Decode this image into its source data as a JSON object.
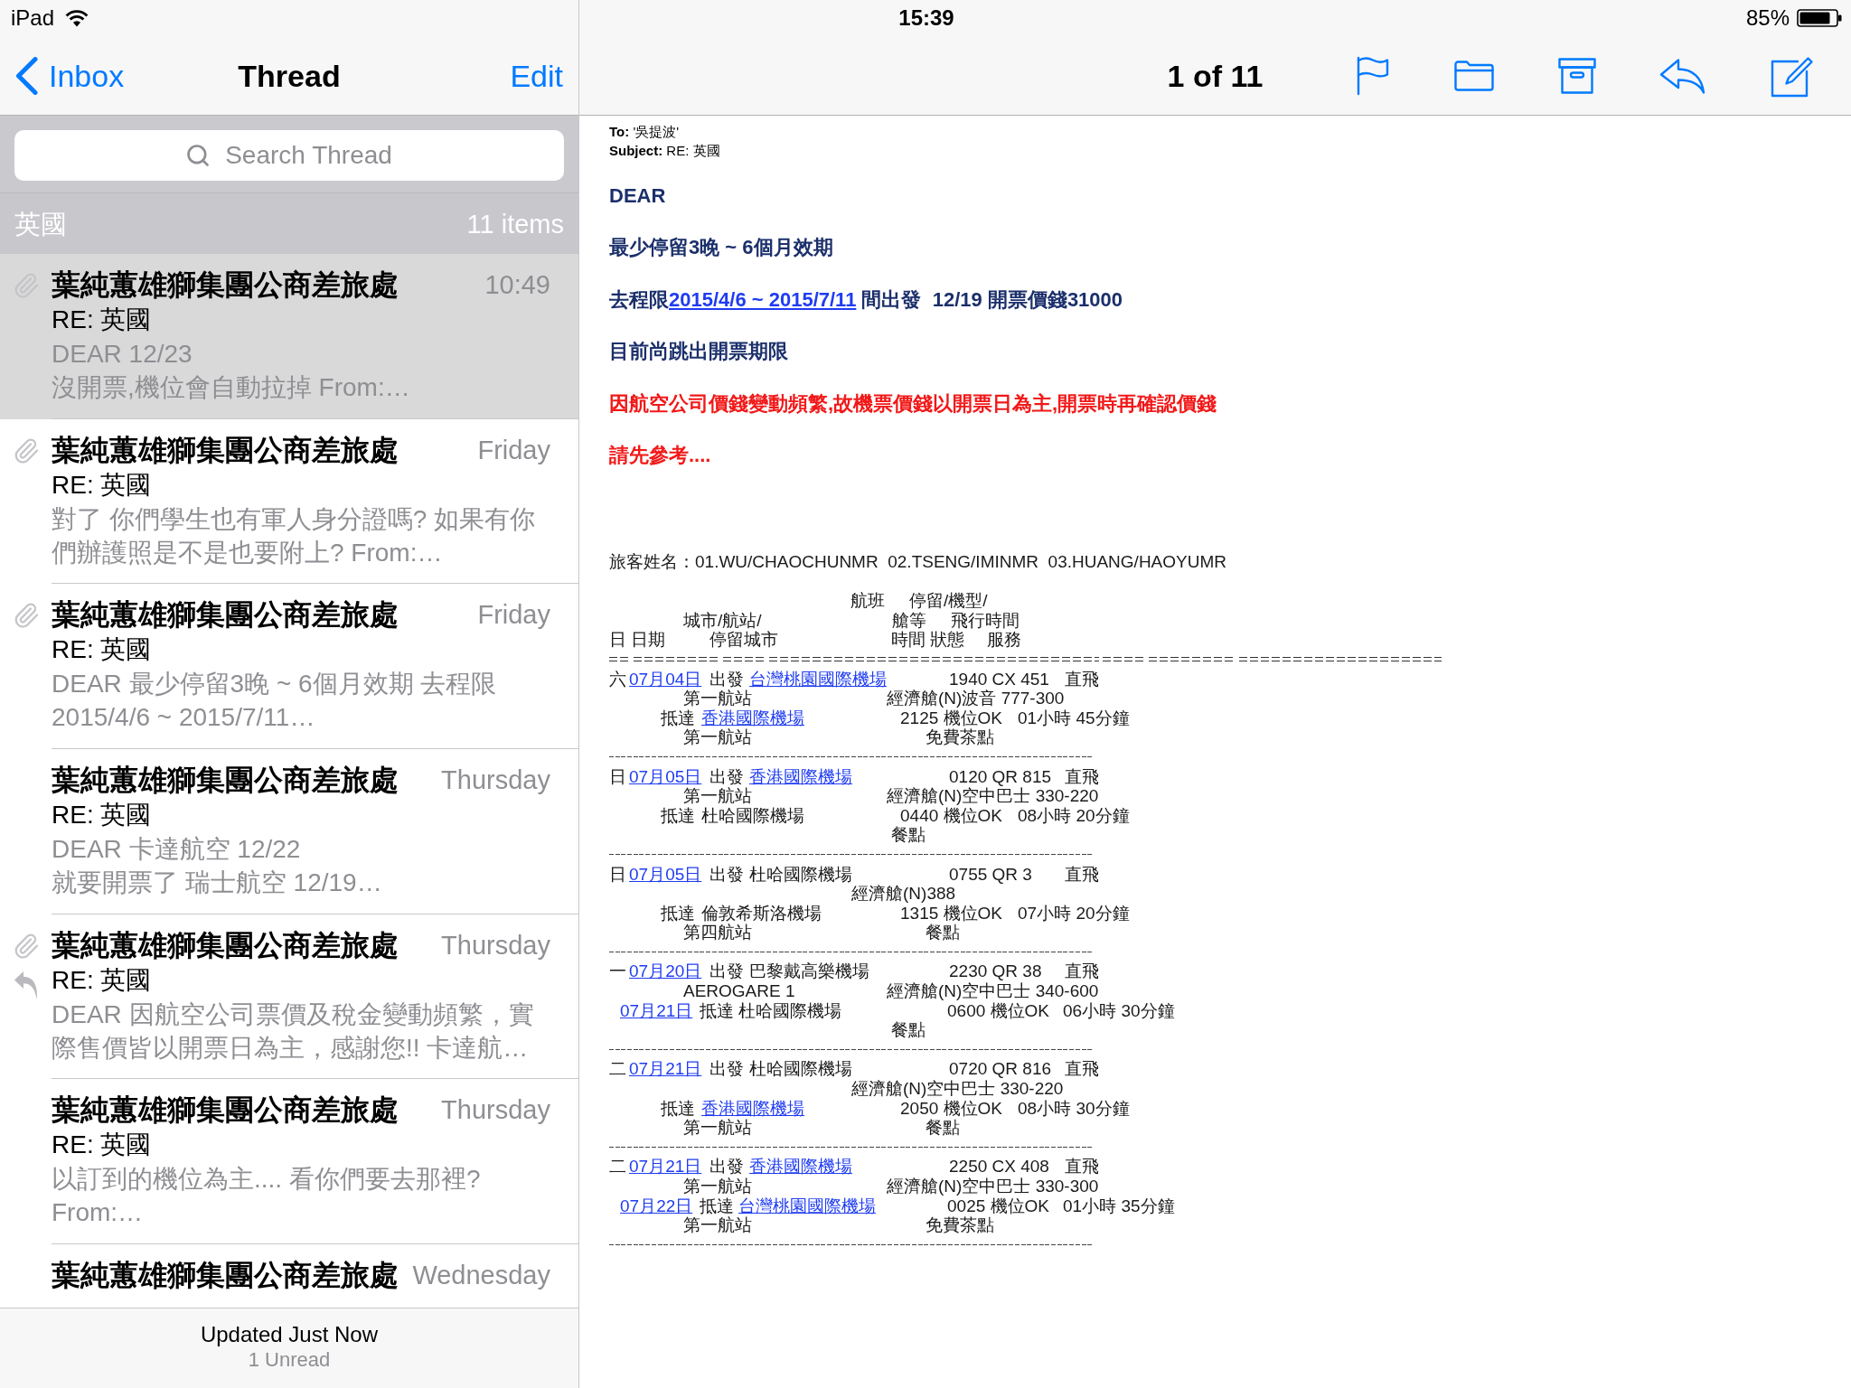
{
  "status_bar": {
    "device": "iPad",
    "time": "15:39",
    "battery": "85%"
  },
  "nav": {
    "back": "Inbox",
    "title": "Thread",
    "edit": "Edit"
  },
  "search": {
    "placeholder": "Search Thread"
  },
  "section": {
    "title": "英國",
    "count": "11 items"
  },
  "messages": [
    {
      "sender": "葉純蕙雄獅集團公商差旅處",
      "time": "10:49",
      "subject": "RE: 英國",
      "preview": "DEAR 12/23\n沒開票,機位會自動拉掉 From:…",
      "attachment": true,
      "replied": false,
      "selected": true
    },
    {
      "sender": "葉純蕙雄獅集團公商差旅處",
      "time": "Friday",
      "subject": "RE: 英國",
      "preview": "對了 你們學生也有軍人身分證嗎? 如果有你們辦護照是不是也要附上? From:…",
      "attachment": true,
      "replied": false,
      "selected": false
    },
    {
      "sender": "葉純蕙雄獅集團公商差旅處",
      "time": "Friday",
      "subject": "RE: 英國",
      "preview": "DEAR 最少停留3晚 ~ 6個月效期 去程限2015/4/6 ~ 2015/7/11…",
      "attachment": true,
      "replied": false,
      "selected": false
    },
    {
      "sender": "葉純蕙雄獅集團公商差旅處",
      "time": "Thursday",
      "subject": "RE: 英國",
      "preview": "DEAR 卡達航空 12/22\n就要開票了 瑞士航空 12/19…",
      "attachment": false,
      "replied": false,
      "selected": false
    },
    {
      "sender": "葉純蕙雄獅集團公商差旅處",
      "time": "Thursday",
      "subject": "RE: 英國",
      "preview": "DEAR 因航空公司票價及稅金變動頻繁，實際售價皆以開票日為主，感謝您!! 卡達航…",
      "attachment": true,
      "replied": true,
      "selected": false
    },
    {
      "sender": "葉純蕙雄獅集團公商差旅處",
      "time": "Thursday",
      "subject": "RE: 英國",
      "preview": "以訂到的機位為主.... 看你們要去那裡? From:…",
      "attachment": false,
      "replied": false,
      "selected": false
    },
    {
      "sender": "葉純蕙雄獅集團公商差旅處",
      "time": "Wednesday",
      "attachment": false,
      "replied": false,
      "selected": false
    }
  ],
  "footer": {
    "status": "Updated Just Now",
    "unread": "1 Unread"
  },
  "toolbar": {
    "position": "1 of 11"
  },
  "email": {
    "headers": [
      "**To:** '吳提波'",
      "**Subject:** RE: 英國"
    ],
    "paragraphs": [
      {
        "kind": "notice",
        "parts": [
          {
            "text": "DEAR",
            "link": false
          }
        ]
      },
      {
        "kind": "notice",
        "parts": [
          {
            "text": "最少停留3晚 ~ 6個月效期",
            "link": false
          }
        ]
      },
      {
        "kind": "notice",
        "parts": [
          {
            "text": "去程限",
            "link": false
          },
          {
            "text": "2015/4/6 ~ 2015/7/11",
            "link": true
          },
          {
            "text": " 間出發  12/19 開票價錢31000",
            "link": false
          }
        ]
      },
      {
        "kind": "notice",
        "parts": [
          {
            "text": "目前尚跳出開票期限",
            "link": false
          }
        ]
      },
      {
        "kind": "alert",
        "parts": [
          {
            "text": "因航空公司價錢變動頻繁,故機票價錢以開票日為主,開票時再確認價錢",
            "link": false
          }
        ]
      },
      {
        "kind": "alert",
        "parts": [
          {
            "text": "請先參考....",
            "link": false
          }
        ]
      }
    ],
    "itinerary": {
      "passengers": "旅客姓名：01.WU/CHAOCHUNMR  02.TSENG/IMINMR  03.HUANG/HAOYUMR",
      "column_headings": [
        [
          "航班",
          "停留/機型/"
        ],
        [
          "城市/航站/",
          "艙等",
          "飛行時間"
        ],
        [
          "日 日期",
          "停留城市",
          "時間 狀態",
          "服務"
        ]
      ],
      "segments": [
        {
          "weekday": "六",
          "date": "07月04日",
          "depart": "出發",
          "from": "台灣桃園國際機場",
          "from_link": true,
          "from_terminal": "第一航站",
          "flight": "1940 CX 451",
          "routing": "直飛",
          "cabin": "經濟艙(N)波音 777-300",
          "arrive": "抵達",
          "to": "香港國際機場",
          "to_link": true,
          "status": "2125 機位OK",
          "duration": "01小時 45分鐘",
          "to_terminal": "第一航站",
          "service": "免費茶點"
        },
        {
          "weekday": "日",
          "date": "07月05日",
          "depart": "出發",
          "from": "香港國際機場",
          "from_link": true,
          "from_terminal": "第一航站",
          "flight": "0120 QR 815",
          "routing": "直飛",
          "cabin": "經濟艙(N)空中巴士 330-220",
          "arrive": "抵達",
          "to": "杜哈國際機場",
          "to_link": false,
          "status": "0440 機位OK",
          "duration": "08小時 20分鐘",
          "service": "餐點"
        },
        {
          "weekday": "日",
          "date": "07月05日",
          "depart": "出發",
          "from": "杜哈國際機場",
          "from_link": false,
          "flight": "0755 QR 3",
          "routing": "直飛",
          "cabin": "經濟艙(N)388",
          "arrive": "抵達",
          "to": "倫敦希斯洛機場",
          "to_link": false,
          "status": "1315 機位OK",
          "duration": "07小時 20分鐘",
          "to_terminal": "第四航站",
          "service": "餐點"
        },
        {
          "weekday": "一",
          "date": "07月20日",
          "depart": "出發",
          "from": "巴黎戴高樂機場",
          "from_link": false,
          "from_terminal": "AEROGARE 1",
          "flight": "2230 QR 38",
          "routing": "直飛",
          "cabin": "經濟艙(N)空中巴士 340-600",
          "arrival_date": "07月21日",
          "arrive": "抵達",
          "to": "杜哈國際機場",
          "to_link": false,
          "status": "0600 機位OK",
          "duration": "06小時 30分鐘",
          "service": "餐點"
        },
        {
          "weekday": "二",
          "date": "07月21日",
          "depart": "出發",
          "from": "杜哈國際機場",
          "from_link": false,
          "flight": "0720 QR 816",
          "routing": "直飛",
          "cabin": "經濟艙(N)空中巴士 330-220",
          "arrive": "抵達",
          "to": "香港國際機場",
          "to_link": true,
          "status": "2050 機位OK",
          "duration": "08小時 30分鐘",
          "to_terminal": "第一航站",
          "service": "餐點"
        },
        {
          "weekday": "二",
          "date": "07月21日",
          "depart": "出發",
          "from": "香港國際機場",
          "from_link": true,
          "from_terminal": "第一航站",
          "flight": "2250 CX 408",
          "routing": "直飛",
          "cabin": "經濟艙(N)空中巴士 330-300",
          "arrival_date": "07月22日",
          "arrive": "抵達",
          "to": "台灣桃園國際機場",
          "to_link": true,
          "status": "0025 機位OK",
          "duration": "01小時 35分鐘",
          "to_terminal": "第一航站",
          "service": "免費茶點"
        }
      ]
    }
  }
}
